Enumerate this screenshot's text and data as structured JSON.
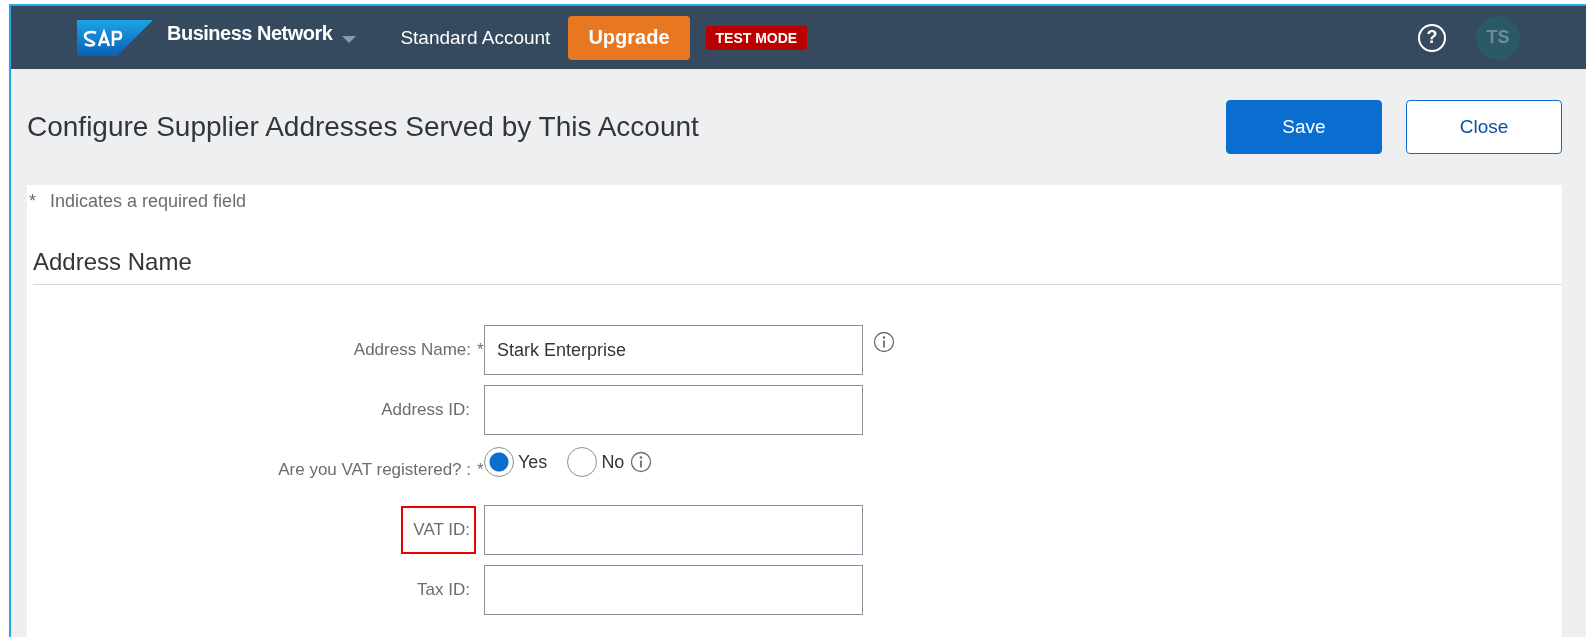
{
  "shell_bar": {
    "product": "Business Network",
    "account": "Standard Account",
    "upgrade_button": "Upgrade",
    "mode_badge": "TEST MODE",
    "help_icon": "?",
    "avatar": "TS"
  },
  "page": {
    "title": "Configure Supplier Addresses Served by This Account",
    "buttons": [
      {
        "label": "Save",
        "kind": "primary"
      },
      {
        "label": "Close",
        "kind": "secondary"
      }
    ]
  },
  "required_note": {
    "mark": "*",
    "text": "Indicates a required field"
  },
  "section": {
    "title": "Address Name"
  },
  "fields": [
    {
      "kind": "text",
      "label": "Address Name:",
      "required": true,
      "highlighted": false,
      "value": "Stark Enterprise",
      "info": true
    },
    {
      "kind": "text",
      "label": "Address ID:",
      "required": false,
      "highlighted": false,
      "info": false
    },
    {
      "kind": "radio",
      "label": "Are you VAT registered? :",
      "required": true,
      "highlighted": false,
      "info": true,
      "options": [
        {
          "label": "Yes",
          "selected": true
        },
        {
          "label": "No",
          "selected": false
        }
      ]
    },
    {
      "kind": "text",
      "label": "VAT ID:",
      "required": false,
      "highlighted": true,
      "info": false
    },
    {
      "kind": "text",
      "label": "Tax ID:",
      "required": false,
      "highlighted": false,
      "info": false
    }
  ]
}
